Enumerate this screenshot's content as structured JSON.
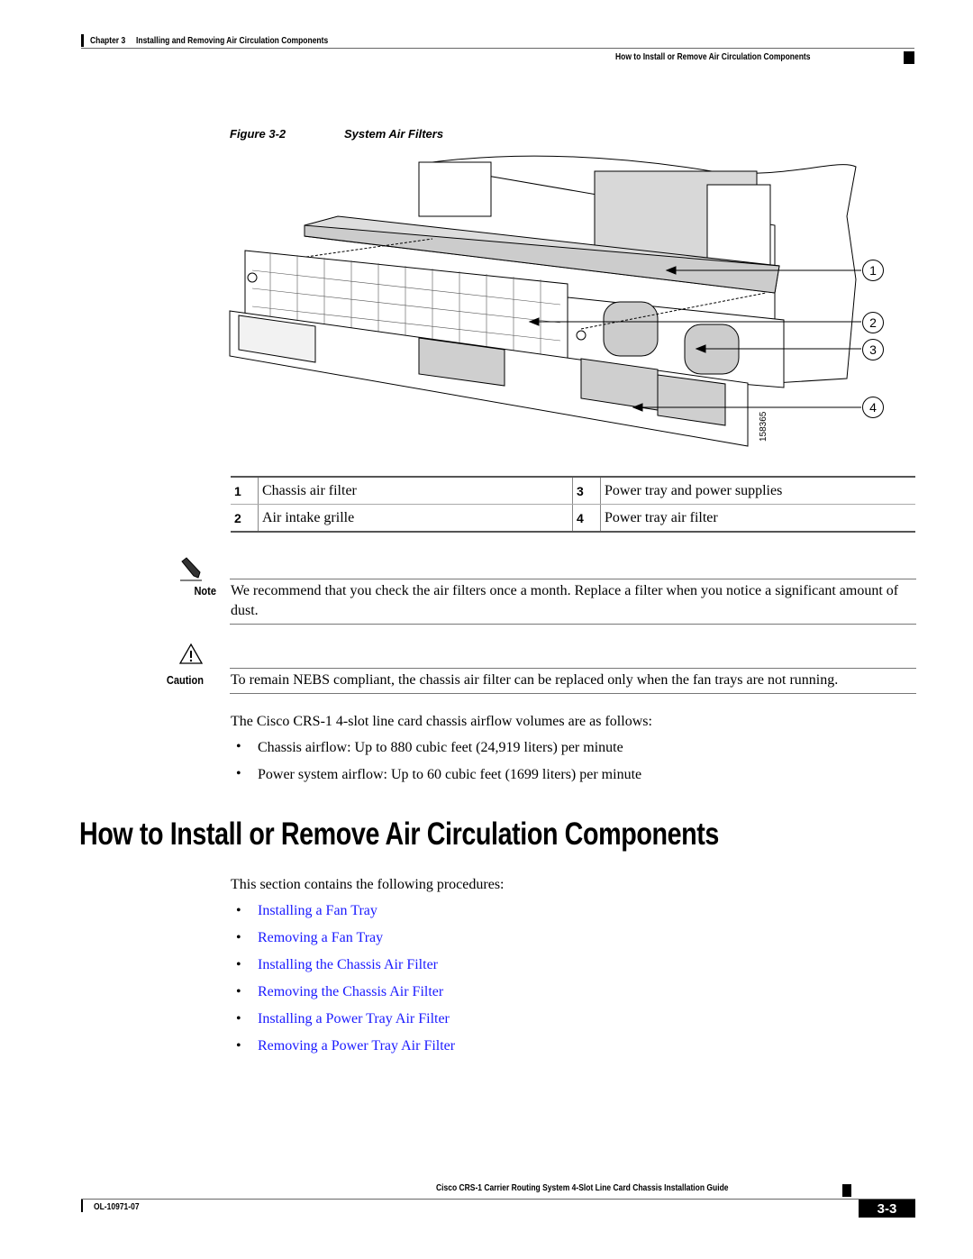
{
  "header": {
    "chapter": "Chapter 3",
    "chapter_title": "Installing and Removing Air Circulation Components",
    "section_title": "How to Install or Remove Air Circulation Components"
  },
  "figure": {
    "number": "Figure 3-2",
    "title": "System Air Filters",
    "art_id": "158365",
    "callouts": [
      "1",
      "2",
      "3",
      "4"
    ],
    "legend": [
      {
        "num": "1",
        "label": "Chassis air filter"
      },
      {
        "num": "2",
        "label": "Air intake grille"
      },
      {
        "num": "3",
        "label": "Power tray and power supplies"
      },
      {
        "num": "4",
        "label": "Power tray air filter"
      }
    ]
  },
  "note": {
    "label": "Note",
    "icon": "pencil-icon",
    "text": "We recommend that you check the air filters once a month. Replace a filter when you notice a significant amount of dust."
  },
  "caution": {
    "label": "Caution",
    "icon": "warning-triangle-icon",
    "text": "To remain NEBS compliant, the chassis air filter can be replaced only when the fan trays are not running."
  },
  "airflow": {
    "intro": "The Cisco CRS-1 4-slot line card chassis airflow volumes are as follows:",
    "items": [
      "Chassis airflow: Up to 880 cubic feet (24,919 liters) per minute",
      "Power system airflow: Up to 60 cubic feet (1699 liters) per minute"
    ]
  },
  "section": {
    "heading": "How to Install or Remove Air Circulation Components",
    "intro": "This section contains the following procedures:",
    "links": [
      "Installing a Fan Tray",
      "Removing a Fan Tray",
      "Installing the Chassis Air Filter",
      "Removing the Chassis Air Filter",
      "Installing a Power Tray Air Filter",
      "Removing a Power Tray Air Filter"
    ]
  },
  "footer": {
    "guide_title": "Cisco CRS-1 Carrier Routing System 4-Slot Line Card Chassis Installation Guide",
    "doc_number": "OL-10971-07",
    "page_number": "3-3"
  }
}
